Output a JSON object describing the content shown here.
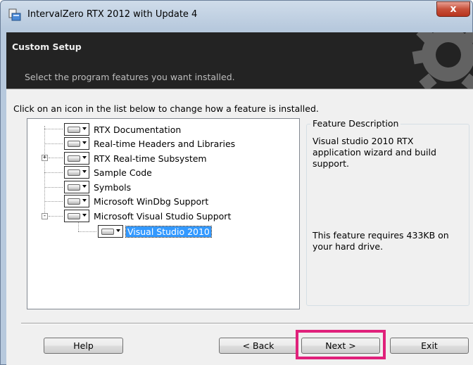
{
  "window": {
    "title": "IntervalZero RTX 2012 with Update 4",
    "close_glyph": "x"
  },
  "banner": {
    "title": "Custom Setup",
    "subtitle": "Select the program features you want installed."
  },
  "instruction": "Click on an icon in the list below to change how a feature is installed.",
  "features": [
    {
      "label": "RTX Documentation"
    },
    {
      "label": "Real-time Headers and Libraries"
    },
    {
      "label": "RTX Real-time Subsystem",
      "expander": "+"
    },
    {
      "label": "Sample Code"
    },
    {
      "label": "Symbols"
    },
    {
      "label": "Microsoft WinDbg Support"
    },
    {
      "label": "Microsoft Visual Studio Support",
      "expander": "-"
    },
    {
      "label": "Visual Studio 2010",
      "selected": true
    }
  ],
  "description": {
    "legend": "Feature Description",
    "text": "Visual studio 2010 RTX application wizard and build support.",
    "requirement": "This feature requires 433KB on your hard drive."
  },
  "buttons": {
    "help": "Help",
    "back": "< Back",
    "next": "Next >",
    "exit": "Exit"
  },
  "colors": {
    "highlight": "#e0217b",
    "selection": "#3399ff",
    "banner": "#232323"
  }
}
